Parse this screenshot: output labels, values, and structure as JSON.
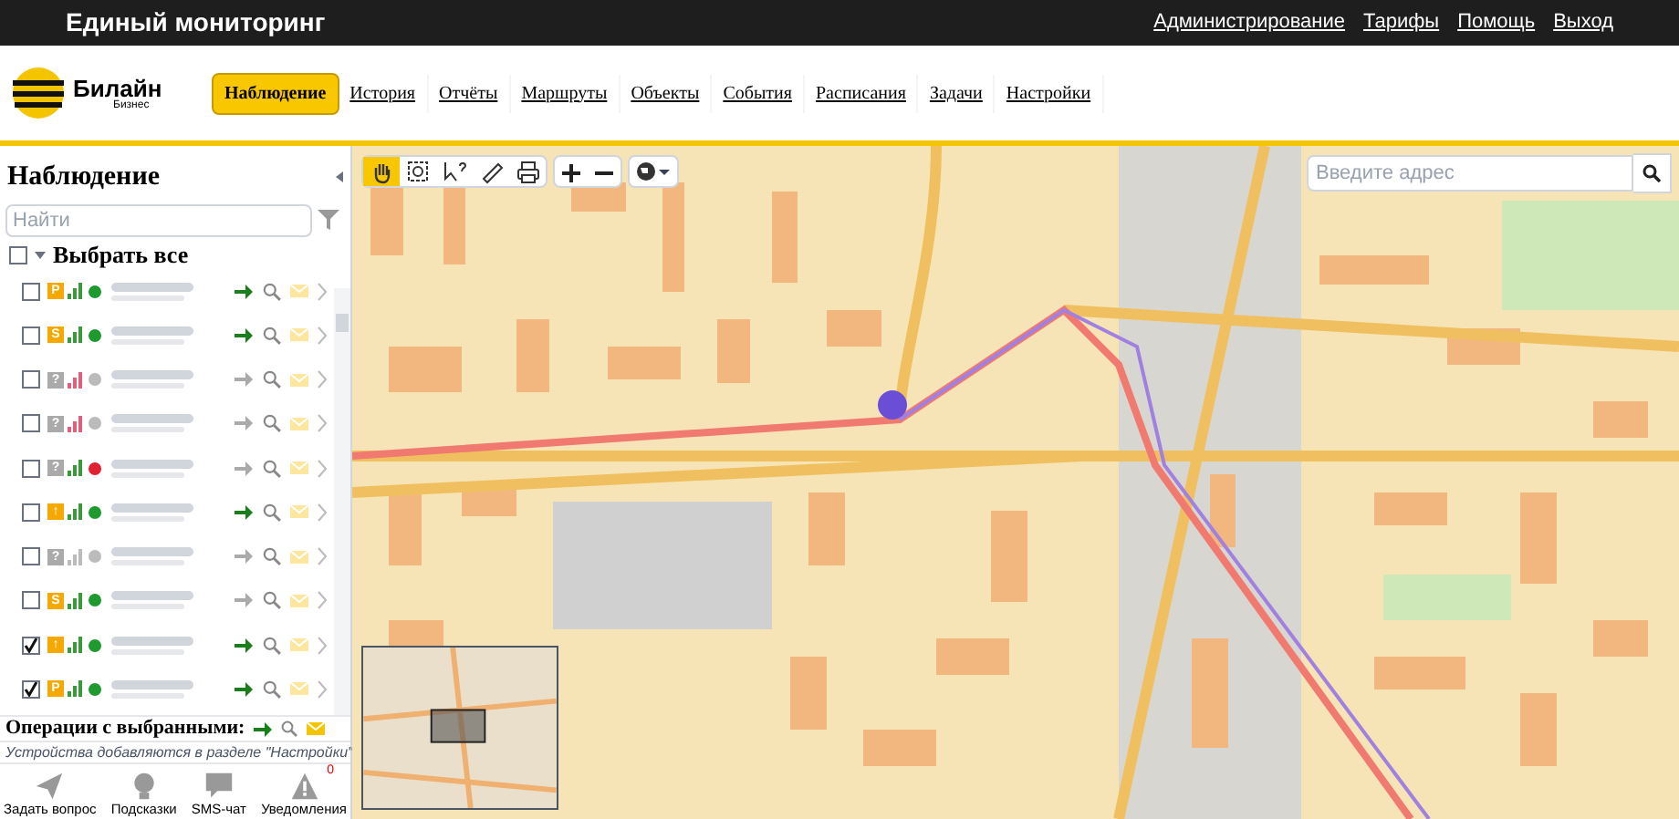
{
  "header": {
    "title": "Единый мониторинг",
    "links": [
      "Администрирование",
      "Тарифы",
      "Помощь",
      "Выход"
    ]
  },
  "brand": {
    "name": "Билайн",
    "sub": "Бизнес"
  },
  "nav": [
    {
      "label": "Наблюдение",
      "selected": true
    },
    {
      "label": "История",
      "selected": false
    },
    {
      "label": "Отчёты",
      "selected": false
    },
    {
      "label": "Маршруты",
      "selected": false
    },
    {
      "label": "Объекты",
      "selected": false
    },
    {
      "label": "События",
      "selected": false
    },
    {
      "label": "Расписания",
      "selected": false
    },
    {
      "label": "Задачи",
      "selected": false
    },
    {
      "label": "Настройки",
      "selected": false
    }
  ],
  "sidebar": {
    "title": "Наблюдение",
    "search": {
      "placeholder": "Найти"
    },
    "select_all": {
      "label": "Выбрать все",
      "checked": false
    },
    "devices": [
      {
        "checked": false,
        "badge": "P",
        "badge_active": true,
        "low_signal": false,
        "no_signal": false,
        "color": "#1f9a2f",
        "moving": true
      },
      {
        "checked": false,
        "badge": "S",
        "badge_active": true,
        "low_signal": false,
        "no_signal": false,
        "color": "#1f9a2f",
        "moving": true
      },
      {
        "checked": false,
        "badge": "?",
        "badge_active": false,
        "low_signal": true,
        "no_signal": false,
        "color": "#bbbbbb",
        "moving": false
      },
      {
        "checked": false,
        "badge": "?",
        "badge_active": false,
        "low_signal": true,
        "no_signal": false,
        "color": "#bbbbbb",
        "moving": false
      },
      {
        "checked": false,
        "badge": "?",
        "badge_active": false,
        "low_signal": false,
        "no_signal": false,
        "color": "#e02030",
        "moving": false
      },
      {
        "checked": false,
        "badge": "↑",
        "badge_active": true,
        "low_signal": false,
        "no_signal": false,
        "color": "#1f9a2f",
        "moving": true
      },
      {
        "checked": false,
        "badge": "?",
        "badge_active": false,
        "low_signal": false,
        "no_signal": true,
        "color": "#bbbbbb",
        "moving": false
      },
      {
        "checked": false,
        "badge": "S",
        "badge_active": true,
        "low_signal": false,
        "no_signal": false,
        "color": "#1f9a2f",
        "moving": false
      },
      {
        "checked": true,
        "badge": "↑",
        "badge_active": true,
        "low_signal": false,
        "no_signal": false,
        "color": "#1f9a2f",
        "moving": true
      },
      {
        "checked": true,
        "badge": "P",
        "badge_active": true,
        "low_signal": false,
        "no_signal": false,
        "color": "#1f9a2f",
        "moving": true
      }
    ],
    "operations": "Операции с выбранными:",
    "note": "Устройства добавляются в разделе \"Настройки\"",
    "bottom": [
      {
        "kind": "question",
        "label": "Задать вопрос"
      },
      {
        "kind": "hint",
        "label": "Подсказки"
      },
      {
        "kind": "chat",
        "label": "SMS-чат"
      },
      {
        "kind": "alert",
        "label": "Уведомления",
        "count": "0"
      }
    ]
  },
  "map": {
    "tools": [
      {
        "kind": "hand",
        "selected": true
      },
      {
        "kind": "zoom",
        "selected": false
      },
      {
        "kind": "pointer",
        "selected": false
      },
      {
        "kind": "ruler",
        "selected": false
      },
      {
        "kind": "print",
        "selected": false
      }
    ],
    "address": {
      "placeholder": "Введите адрес"
    }
  }
}
